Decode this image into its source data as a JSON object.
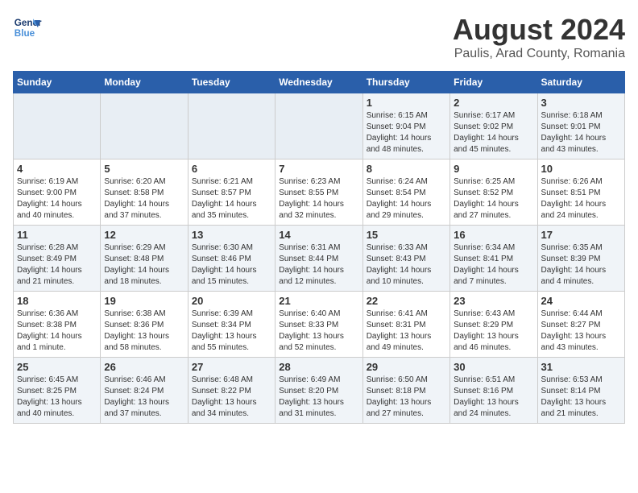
{
  "header": {
    "logo_line1": "General",
    "logo_line2": "Blue",
    "month_year": "August 2024",
    "location": "Paulis, Arad County, Romania"
  },
  "weekdays": [
    "Sunday",
    "Monday",
    "Tuesday",
    "Wednesday",
    "Thursday",
    "Friday",
    "Saturday"
  ],
  "weeks": [
    [
      {
        "day": "",
        "info": ""
      },
      {
        "day": "",
        "info": ""
      },
      {
        "day": "",
        "info": ""
      },
      {
        "day": "",
        "info": ""
      },
      {
        "day": "1",
        "info": "Sunrise: 6:15 AM\nSunset: 9:04 PM\nDaylight: 14 hours\nand 48 minutes."
      },
      {
        "day": "2",
        "info": "Sunrise: 6:17 AM\nSunset: 9:02 PM\nDaylight: 14 hours\nand 45 minutes."
      },
      {
        "day": "3",
        "info": "Sunrise: 6:18 AM\nSunset: 9:01 PM\nDaylight: 14 hours\nand 43 minutes."
      }
    ],
    [
      {
        "day": "4",
        "info": "Sunrise: 6:19 AM\nSunset: 9:00 PM\nDaylight: 14 hours\nand 40 minutes."
      },
      {
        "day": "5",
        "info": "Sunrise: 6:20 AM\nSunset: 8:58 PM\nDaylight: 14 hours\nand 37 minutes."
      },
      {
        "day": "6",
        "info": "Sunrise: 6:21 AM\nSunset: 8:57 PM\nDaylight: 14 hours\nand 35 minutes."
      },
      {
        "day": "7",
        "info": "Sunrise: 6:23 AM\nSunset: 8:55 PM\nDaylight: 14 hours\nand 32 minutes."
      },
      {
        "day": "8",
        "info": "Sunrise: 6:24 AM\nSunset: 8:54 PM\nDaylight: 14 hours\nand 29 minutes."
      },
      {
        "day": "9",
        "info": "Sunrise: 6:25 AM\nSunset: 8:52 PM\nDaylight: 14 hours\nand 27 minutes."
      },
      {
        "day": "10",
        "info": "Sunrise: 6:26 AM\nSunset: 8:51 PM\nDaylight: 14 hours\nand 24 minutes."
      }
    ],
    [
      {
        "day": "11",
        "info": "Sunrise: 6:28 AM\nSunset: 8:49 PM\nDaylight: 14 hours\nand 21 minutes."
      },
      {
        "day": "12",
        "info": "Sunrise: 6:29 AM\nSunset: 8:48 PM\nDaylight: 14 hours\nand 18 minutes."
      },
      {
        "day": "13",
        "info": "Sunrise: 6:30 AM\nSunset: 8:46 PM\nDaylight: 14 hours\nand 15 minutes."
      },
      {
        "day": "14",
        "info": "Sunrise: 6:31 AM\nSunset: 8:44 PM\nDaylight: 14 hours\nand 12 minutes."
      },
      {
        "day": "15",
        "info": "Sunrise: 6:33 AM\nSunset: 8:43 PM\nDaylight: 14 hours\nand 10 minutes."
      },
      {
        "day": "16",
        "info": "Sunrise: 6:34 AM\nSunset: 8:41 PM\nDaylight: 14 hours\nand 7 minutes."
      },
      {
        "day": "17",
        "info": "Sunrise: 6:35 AM\nSunset: 8:39 PM\nDaylight: 14 hours\nand 4 minutes."
      }
    ],
    [
      {
        "day": "18",
        "info": "Sunrise: 6:36 AM\nSunset: 8:38 PM\nDaylight: 14 hours\nand 1 minute."
      },
      {
        "day": "19",
        "info": "Sunrise: 6:38 AM\nSunset: 8:36 PM\nDaylight: 13 hours\nand 58 minutes."
      },
      {
        "day": "20",
        "info": "Sunrise: 6:39 AM\nSunset: 8:34 PM\nDaylight: 13 hours\nand 55 minutes."
      },
      {
        "day": "21",
        "info": "Sunrise: 6:40 AM\nSunset: 8:33 PM\nDaylight: 13 hours\nand 52 minutes."
      },
      {
        "day": "22",
        "info": "Sunrise: 6:41 AM\nSunset: 8:31 PM\nDaylight: 13 hours\nand 49 minutes."
      },
      {
        "day": "23",
        "info": "Sunrise: 6:43 AM\nSunset: 8:29 PM\nDaylight: 13 hours\nand 46 minutes."
      },
      {
        "day": "24",
        "info": "Sunrise: 6:44 AM\nSunset: 8:27 PM\nDaylight: 13 hours\nand 43 minutes."
      }
    ],
    [
      {
        "day": "25",
        "info": "Sunrise: 6:45 AM\nSunset: 8:25 PM\nDaylight: 13 hours\nand 40 minutes."
      },
      {
        "day": "26",
        "info": "Sunrise: 6:46 AM\nSunset: 8:24 PM\nDaylight: 13 hours\nand 37 minutes."
      },
      {
        "day": "27",
        "info": "Sunrise: 6:48 AM\nSunset: 8:22 PM\nDaylight: 13 hours\nand 34 minutes."
      },
      {
        "day": "28",
        "info": "Sunrise: 6:49 AM\nSunset: 8:20 PM\nDaylight: 13 hours\nand 31 minutes."
      },
      {
        "day": "29",
        "info": "Sunrise: 6:50 AM\nSunset: 8:18 PM\nDaylight: 13 hours\nand 27 minutes."
      },
      {
        "day": "30",
        "info": "Sunrise: 6:51 AM\nSunset: 8:16 PM\nDaylight: 13 hours\nand 24 minutes."
      },
      {
        "day": "31",
        "info": "Sunrise: 6:53 AM\nSunset: 8:14 PM\nDaylight: 13 hours\nand 21 minutes."
      }
    ]
  ],
  "row_styles": [
    "shaded",
    "white",
    "shaded",
    "white",
    "shaded"
  ]
}
